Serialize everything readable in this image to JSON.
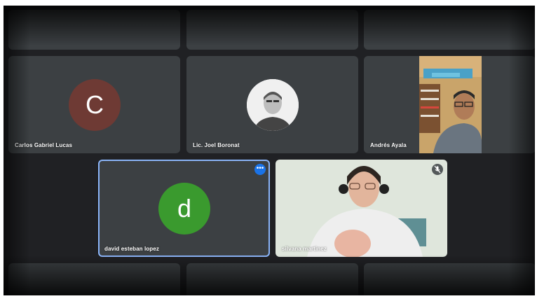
{
  "colors": {
    "background": "#202124",
    "tile": "#3c4043",
    "active_border": "#8ab4f8",
    "more_button": "#1a73e8",
    "avatar_c": "#6e3a34",
    "avatar_d": "#3a9a2e"
  },
  "participants": [
    {
      "name": "Carlos Gabriel Lucas",
      "initial": "C",
      "type": "initial-avatar"
    },
    {
      "name": "Lic. Joel Boronat",
      "type": "photo-avatar"
    },
    {
      "name": "Andrés Ayala",
      "type": "video"
    },
    {
      "name": "david esteban lopez",
      "initial": "d",
      "type": "initial-avatar",
      "active": true
    },
    {
      "name": "silvana martinez",
      "type": "video",
      "muted": true
    }
  ],
  "icons": {
    "more": "more-options-icon",
    "mute": "mic-off-icon"
  }
}
